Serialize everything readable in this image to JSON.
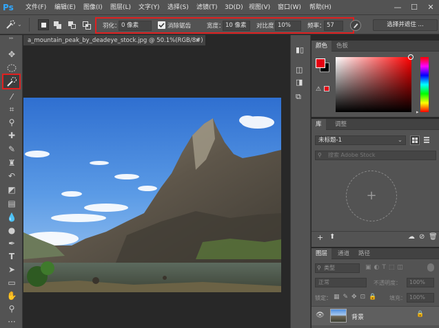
{
  "app": {
    "logo": "Ps"
  },
  "menu": [
    "文件(F)",
    "编辑(E)",
    "图像(I)",
    "图层(L)",
    "文字(Y)",
    "选择(S)",
    "滤镜(T)",
    "3D(D)",
    "视图(V)",
    "窗口(W)",
    "帮助(H)"
  ],
  "window_controls": {
    "minimize": "—",
    "maximize": "☐",
    "close": "✕"
  },
  "options": {
    "feather_label": "羽化：",
    "feather_value": "0 像素",
    "antialias_label": "消除锯齿",
    "antialias_checked": true,
    "width_label": "宽度：",
    "width_value": "10 像素",
    "contrast_label": "对比度：",
    "contrast_value": "10%",
    "frequency_label": "频率：",
    "frequency_value": "57",
    "select_mask_label": "选择并遮住 ..."
  },
  "document": {
    "tab_title": "a_mountain_peak_by_deadeye_stock.jpg @ 50.1%(RGB/8#) *",
    "close": "×"
  },
  "color_panel": {
    "tabs": [
      "颜色",
      "色板"
    ],
    "foreground": "#e60012",
    "background": "#000000",
    "hue_marker": "#ff0000"
  },
  "libraries_panel": {
    "tabs": [
      "库",
      "调整"
    ],
    "library_select": "未标题-1",
    "search_placeholder": "搜索 Adobe Stock"
  },
  "layers_panel": {
    "tabs": [
      "图层",
      "通道",
      "路径"
    ],
    "kind_label": "类型",
    "blend_mode": "正常",
    "opacity_label": "不透明度：",
    "opacity_value": "100%",
    "lock_label": "锁定：",
    "fill_label": "填充：",
    "fill_value": "100%",
    "layers": [
      {
        "name": "背景",
        "locked": true,
        "visible": true
      }
    ]
  }
}
